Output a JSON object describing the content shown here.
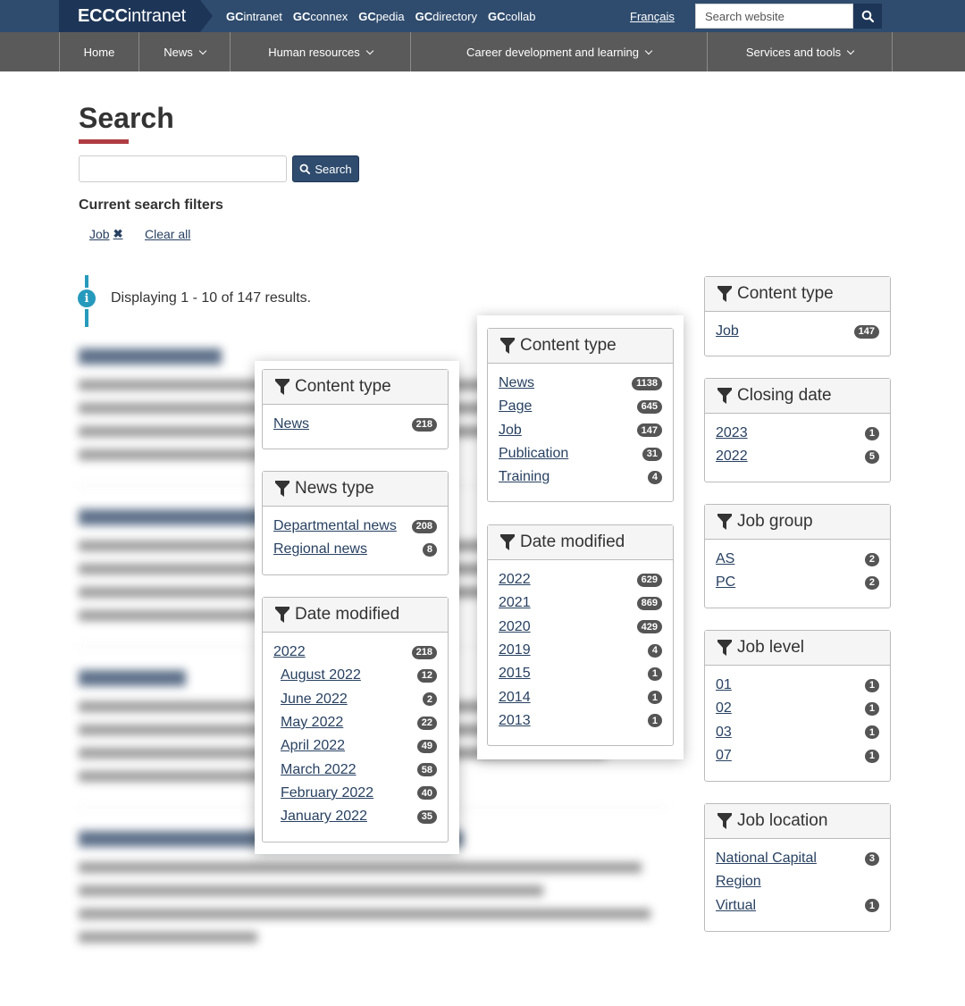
{
  "topbar": {
    "brand_bold": "ECCC",
    "brand_rest": "intranet",
    "links": [
      {
        "prefix": "GC",
        "rest": "intranet"
      },
      {
        "prefix": "GC",
        "rest": "connex"
      },
      {
        "prefix": "GC",
        "rest": "pedia"
      },
      {
        "prefix": "GC",
        "rest": "directory"
      },
      {
        "prefix": "GC",
        "rest": "collab"
      }
    ],
    "language": "Français",
    "search_placeholder": "Search website"
  },
  "nav": {
    "home": "Home",
    "news": "News",
    "hr": "Human resources",
    "career": "Career development and learning",
    "services": "Services and tools"
  },
  "page": {
    "title": "Search",
    "search_button": "Search",
    "filters_heading": "Current search filters",
    "active_filter": "Job",
    "clear_all": "Clear all",
    "results_info": "Displaying 1 - 10 of 147 results."
  },
  "colors": {
    "topbar": "#2f4c6e",
    "brand": "#1d3557",
    "nav": "#5a5a5a",
    "accent_red": "#af3c43",
    "info_blue": "#269abc",
    "link": "#284162"
  },
  "sidebar": {
    "content_type": {
      "title": "Content type",
      "items": [
        {
          "label": "Job",
          "count": "147"
        }
      ]
    },
    "closing_date": {
      "title": "Closing date",
      "items": [
        {
          "label": "2023",
          "count": "1"
        },
        {
          "label": "2022",
          "count": "5"
        }
      ]
    },
    "job_group": {
      "title": "Job group",
      "items": [
        {
          "label": "AS",
          "count": "2"
        },
        {
          "label": "PC",
          "count": "2"
        }
      ]
    },
    "job_level": {
      "title": "Job level",
      "items": [
        {
          "label": "01",
          "count": "1"
        },
        {
          "label": "02",
          "count": "1"
        },
        {
          "label": "03",
          "count": "1"
        },
        {
          "label": "07",
          "count": "1"
        }
      ]
    },
    "job_location": {
      "title": "Job location",
      "items": [
        {
          "label": "National Capital",
          "label2": "Region",
          "count": "3"
        },
        {
          "label": "Virtual",
          "count": "1"
        }
      ]
    }
  },
  "popup_left": {
    "content_type": {
      "title": "Content type",
      "items": [
        {
          "label": "News",
          "count": "218"
        }
      ]
    },
    "news_type": {
      "title": "News type",
      "items": [
        {
          "label": "Departmental news",
          "count": "208"
        },
        {
          "label": "Regional news",
          "count": "8"
        }
      ]
    },
    "date_modified": {
      "title": "Date modified",
      "items": [
        {
          "label": "2022",
          "count": "218"
        },
        {
          "label": "August 2022",
          "count": "12"
        },
        {
          "label": "June 2022",
          "count": "2"
        },
        {
          "label": "May 2022",
          "count": "22"
        },
        {
          "label": "April 2022",
          "count": "49"
        },
        {
          "label": "March 2022",
          "count": "58"
        },
        {
          "label": "February 2022",
          "count": "40"
        },
        {
          "label": "January 2022",
          "count": "35"
        }
      ]
    }
  },
  "popup_right": {
    "content_type": {
      "title": "Content type",
      "items": [
        {
          "label": "News",
          "count": "1138"
        },
        {
          "label": "Page",
          "count": "645"
        },
        {
          "label": "Job",
          "count": "147"
        },
        {
          "label": "Publication",
          "count": "31"
        },
        {
          "label": "Training",
          "count": "4"
        }
      ]
    },
    "date_modified": {
      "title": "Date modified",
      "items": [
        {
          "label": "2022",
          "count": "629"
        },
        {
          "label": "2021",
          "count": "869"
        },
        {
          "label": "2020",
          "count": "429"
        },
        {
          "label": "2019",
          "count": "4"
        },
        {
          "label": "2015",
          "count": "1"
        },
        {
          "label": "2014",
          "count": "1"
        },
        {
          "label": "2013",
          "count": "1"
        }
      ]
    }
  }
}
